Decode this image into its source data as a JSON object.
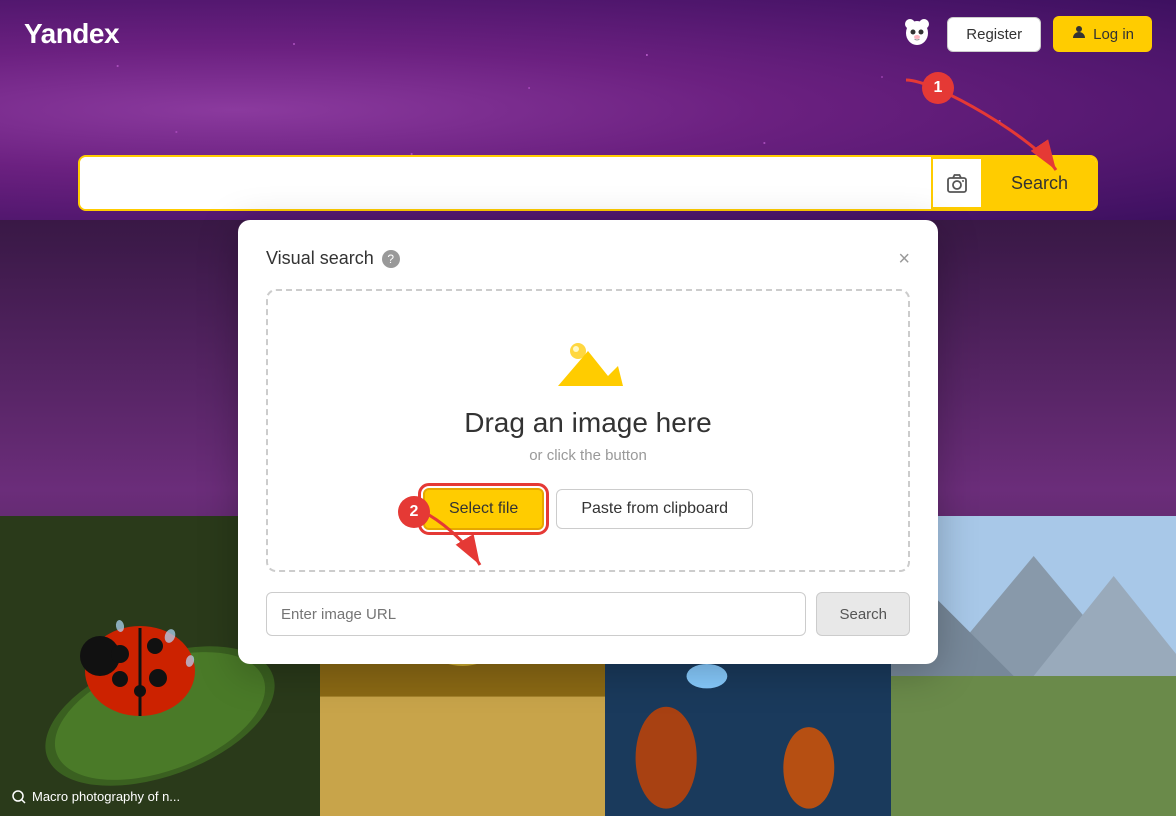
{
  "app": {
    "name": "Yandex"
  },
  "header": {
    "logo": "Yandex",
    "register_label": "Register",
    "login_label": "Log in"
  },
  "search": {
    "input_placeholder": "",
    "search_button_label": "Search",
    "camera_button_label": "Visual search"
  },
  "visual_search_modal": {
    "title": "Visual search",
    "help_tooltip": "?",
    "close_label": "×",
    "drag_text": "Drag an image here",
    "or_text": "or click the button",
    "select_file_label": "Select file",
    "paste_label": "Paste from clipboard",
    "url_placeholder": "Enter image URL",
    "url_search_label": "Search"
  },
  "annotations": {
    "circle_1": "1",
    "circle_2": "2"
  },
  "image_grid": {
    "cell1_label": "Macro photography of n..."
  },
  "colors": {
    "accent": "#ffcc00",
    "danger": "#e53935",
    "bg_purple": "#6b2d7a"
  }
}
